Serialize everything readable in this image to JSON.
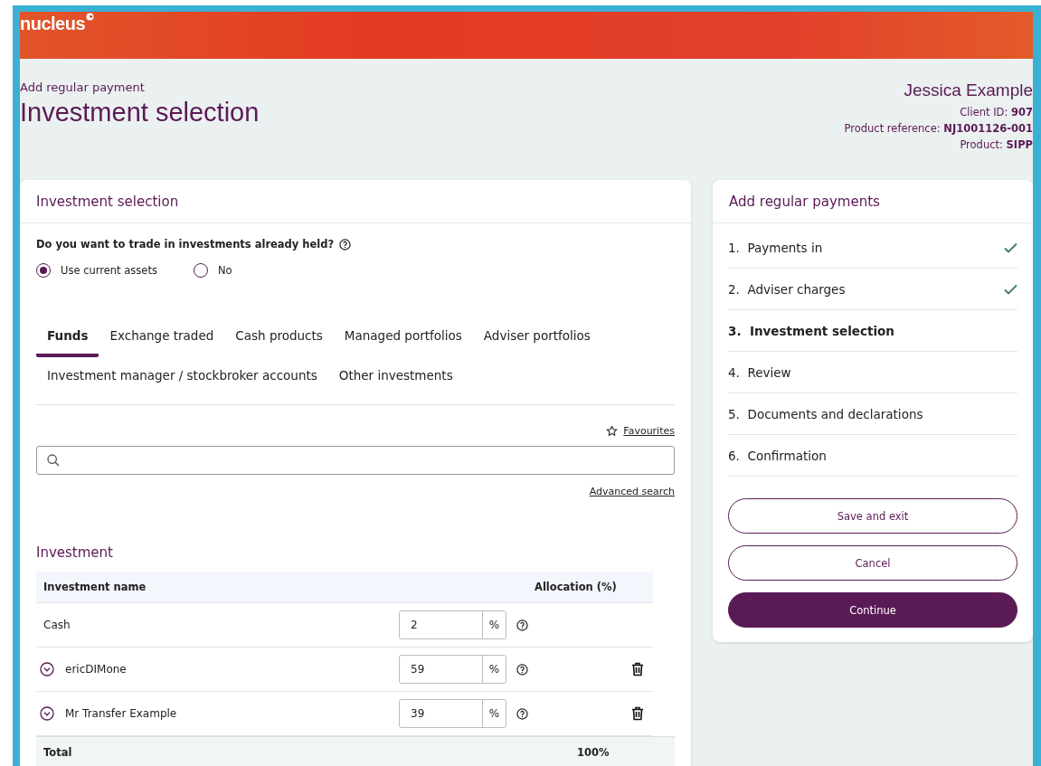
{
  "brand": {
    "logo": "nucleus"
  },
  "page": {
    "subtitle": "Add regular payment",
    "title": "Investment selection"
  },
  "client": {
    "name": "Jessica Example",
    "details": [
      "Client ID: **907**",
      "Product reference: **NJ1001126-001**",
      "Product: **SIPP**"
    ]
  },
  "main": {
    "heading": "Investment selection",
    "question": "Do you want to trade in investments already held?",
    "options": [
      {
        "label": "Use current assets",
        "selected": true
      },
      {
        "label": "No",
        "selected": false
      }
    ],
    "tabs": [
      {
        "label": "Funds",
        "selected": true
      },
      {
        "label": "Exchange traded",
        "selected": false
      },
      {
        "label": "Cash products",
        "selected": false
      },
      {
        "label": "Managed portfolios",
        "selected": false
      },
      {
        "label": "Adviser portfolios",
        "selected": false
      },
      {
        "label": "Investment manager / stockbroker accounts",
        "selected": false
      },
      {
        "label": "Other investments",
        "selected": false
      }
    ],
    "favourites": "Favourites",
    "advanced_search": "Advanced search",
    "table": {
      "title": "Investment",
      "columns": [
        "Investment name",
        "Allocation (%)"
      ],
      "rows": [
        {
          "name": "Cash",
          "value": "2",
          "unit": "%",
          "expandable": false,
          "removable": false
        },
        {
          "name": "ericDIMone",
          "value": "59",
          "unit": "%",
          "expandable": true,
          "removable": true
        },
        {
          "name": "Mr Transfer Example",
          "value": "39",
          "unit": "%",
          "expandable": true,
          "removable": true
        }
      ],
      "total": {
        "label": "Total",
        "value": "100%"
      }
    }
  },
  "side": {
    "heading": "Add regular payments",
    "steps": [
      {
        "number": "1.",
        "label": "Payments in",
        "completed": true,
        "selected": false
      },
      {
        "number": "2.",
        "label": "Adviser charges",
        "completed": true,
        "selected": false
      },
      {
        "number": "3.",
        "label": "Investment selection",
        "completed": false,
        "selected": true
      },
      {
        "number": "4.",
        "label": "Review",
        "completed": false,
        "selected": false
      },
      {
        "number": "5.",
        "label": "Documents and declarations",
        "completed": false,
        "selected": false
      },
      {
        "number": "6.",
        "label": "Confirmation",
        "completed": false,
        "selected": false
      }
    ],
    "buttons": [
      {
        "label": "Save and exit",
        "kind": "outline"
      },
      {
        "label": "Cancel",
        "kind": "outline"
      },
      {
        "label": "Continue",
        "kind": "primary"
      }
    ]
  }
}
